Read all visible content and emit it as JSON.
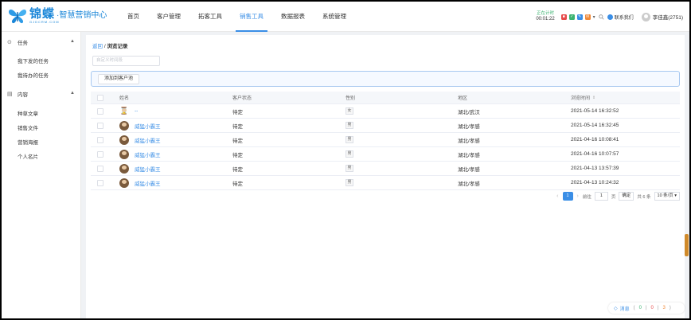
{
  "brand": {
    "name": "锦蝶",
    "slogan": "·智慧营销中心",
    "sub": "GJDCRM.COM"
  },
  "nav": [
    {
      "label": "首页"
    },
    {
      "label": "客户管理"
    },
    {
      "label": "拓客工具"
    },
    {
      "label": "销售工具",
      "active": true
    },
    {
      "label": "数据报表"
    },
    {
      "label": "系统管理"
    }
  ],
  "header_right": {
    "timer_label": "正在计时",
    "timer_value": "00:01:22",
    "contact": "联系我们",
    "user": "李佳鑫(2751)"
  },
  "sidebar": {
    "sections": [
      {
        "title": "任务",
        "items": [
          "我下发的任务",
          "我待办的任务"
        ]
      },
      {
        "title": "内容",
        "items": [
          "种草文章",
          "销售文件",
          "营销海报",
          "个人名片"
        ]
      }
    ]
  },
  "breadcrumb": {
    "back": "返回",
    "sep": "/",
    "current": "浏览记录"
  },
  "search": {
    "placeholder": "自定义时间段"
  },
  "add_button": "添加到客户池",
  "table": {
    "columns": [
      "姓名",
      "客户状态",
      "性别",
      "地区",
      "浏览时间"
    ],
    "rows": [
      {
        "name": "--",
        "status": "待定",
        "gender": "女",
        "region": "湖北/武汉",
        "time": "2021-05-14 16:32:52",
        "avatar": "hourglass"
      },
      {
        "name": "威猛小霸王",
        "status": "待定",
        "gender": "男",
        "region": "湖北/孝感",
        "time": "2021-05-14 16:32:45",
        "avatar": "photo"
      },
      {
        "name": "威猛小霸王",
        "status": "待定",
        "gender": "男",
        "region": "湖北/孝感",
        "time": "2021-04-16 10:08:41",
        "avatar": "photo"
      },
      {
        "name": "威猛小霸王",
        "status": "待定",
        "gender": "男",
        "region": "湖北/孝感",
        "time": "2021-04-16 10:07:57",
        "avatar": "photo"
      },
      {
        "name": "威猛小霸王",
        "status": "待定",
        "gender": "男",
        "region": "湖北/孝感",
        "time": "2021-04-13 13:57:39",
        "avatar": "photo"
      },
      {
        "name": "威猛小霸王",
        "status": "待定",
        "gender": "男",
        "region": "湖北/孝感",
        "time": "2021-04-13 10:24:32",
        "avatar": "photo"
      }
    ]
  },
  "pagination": {
    "current": "1",
    "goto_label": "前往",
    "goto_value": "1",
    "page_unit": "页",
    "confirm": "确定",
    "total": "共 6 条",
    "page_size": "10 条/页"
  },
  "messages": {
    "label": "消息",
    "open": "(",
    "counts": [
      "0",
      "0",
      "3"
    ],
    "close": ")",
    "sep": "|"
  },
  "colors": {
    "accent": "#3a8ee6",
    "logo": "#1a86d8",
    "timer": "#3cb371"
  }
}
